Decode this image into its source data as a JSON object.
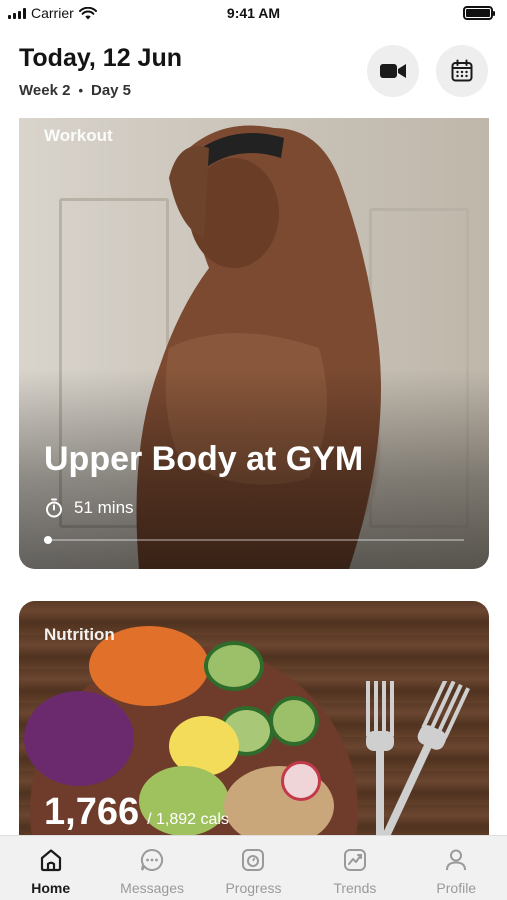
{
  "status_bar": {
    "carrier": "Carrier",
    "time": "9:41 AM"
  },
  "header": {
    "date_title": "Today, 12 Jun",
    "week": "Week 2",
    "separator": "•",
    "day": "Day 5",
    "video_icon": "video-camera-icon",
    "calendar_icon": "calendar-icon"
  },
  "workout": {
    "label": "Workout",
    "title": "Upper Body at GYM",
    "duration": "51 mins",
    "timer_icon": "stopwatch-icon",
    "progress": 0.01
  },
  "nutrition": {
    "label": "Nutrition",
    "calories": "1,766",
    "calories_total": "/ 1,892 cals"
  },
  "tabs": [
    {
      "label": "Home",
      "icon": "home-icon",
      "active": true
    },
    {
      "label": "Messages",
      "icon": "chat-bubble-icon",
      "active": false
    },
    {
      "label": "Progress",
      "icon": "scale-icon",
      "active": false
    },
    {
      "label": "Trends",
      "icon": "trend-chart-icon",
      "active": false
    },
    {
      "label": "Profile",
      "icon": "person-icon",
      "active": false
    }
  ],
  "colors": {
    "background": "#ffffff",
    "tab_bar": "#f2f1f1",
    "active_tab": "#1a1a1a",
    "inactive_tab": "#9a9a9a",
    "header_button": "#eeeeee"
  }
}
